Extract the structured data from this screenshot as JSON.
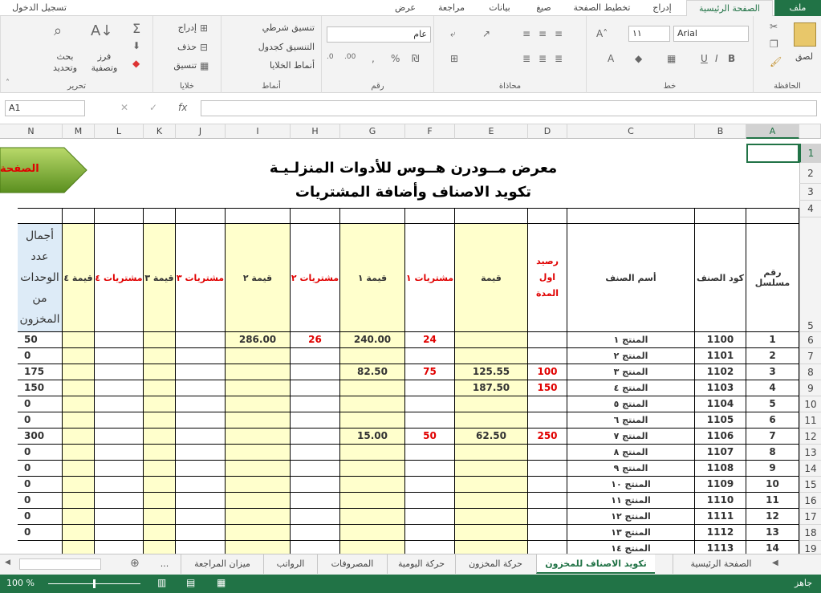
{
  "ribbon_tabs": [
    "ملف",
    "الصفحة الرئيسية",
    "إدراج",
    "تخطيط الصفحة",
    "صيغ",
    "بيانات",
    "مراجعة",
    "عرض"
  ],
  "signin": "تسجيل الدخول",
  "groups": {
    "clipboard": "الحافظة",
    "font": "خط",
    "alignment": "محاذاة",
    "number": "رقم",
    "styles": "أنماط",
    "cells": "خلايا",
    "editing": "تحرير"
  },
  "paste_label": "لصق",
  "font_name": "Arial",
  "font_size": "١١",
  "number_format": "عام",
  "styles_items": [
    "تنسيق شرطي",
    "التنسيق كجدول",
    "أنماط الخلايا"
  ],
  "cells_items": [
    "إدراج",
    "حذف",
    "تنسيق"
  ],
  "sort_label": "فرز وتصفية",
  "find_label": "بحث وتحديد",
  "name_box": "A1",
  "fx": "fx",
  "columns": [
    "A",
    "B",
    "C",
    "D",
    "E",
    "F",
    "G",
    "H",
    "I",
    "J",
    "K",
    "L",
    "M",
    "N"
  ],
  "rows": [
    "1",
    "2",
    "3",
    "4",
    "5",
    "6",
    "7",
    "8",
    "9",
    "10",
    "11",
    "12",
    "13",
    "14",
    "15",
    "16",
    "17",
    "18",
    "19"
  ],
  "title1": "معرض مــودرن هــوس للأدوات المنزلـيـة",
  "title2": "تكويد الاصناف وأضافة المشتريات",
  "nav_button": "الصفحة",
  "headers": {
    "serial": "رقم مسلسل",
    "code": "كود الصنف",
    "name": "أسم الصنف",
    "opening": "رصيد اول المدة",
    "value": "قيمة",
    "p1": "مشتريات ١",
    "v1": "قيمة ١",
    "p2": "مشتريات ٢",
    "v2": "قيمة ٢",
    "p3": "مشتريات ٣",
    "v3": "قيمة ٣",
    "p4": "مشتريات ٤",
    "v4": "قيمة ٤",
    "total": "أجمال عدد الوحدات من المخزون"
  },
  "table": [
    {
      "a": "1",
      "b": "1100",
      "c": "المنتج ١",
      "d": "",
      "e": "",
      "f": "24",
      "g": "240.00",
      "h": "26",
      "i": "286.00",
      "n": "50"
    },
    {
      "a": "2",
      "b": "1101",
      "c": "المنتج ٢",
      "d": "",
      "e": "",
      "f": "",
      "g": "",
      "h": "",
      "i": "",
      "n": "0"
    },
    {
      "a": "3",
      "b": "1102",
      "c": "المنتج ٣",
      "d": "100",
      "e": "125.55",
      "f": "75",
      "g": "82.50",
      "h": "",
      "i": "",
      "n": "175"
    },
    {
      "a": "4",
      "b": "1103",
      "c": "المنتج ٤",
      "d": "150",
      "e": "187.50",
      "f": "",
      "g": "",
      "h": "",
      "i": "",
      "n": "150"
    },
    {
      "a": "5",
      "b": "1104",
      "c": "المنتج ٥",
      "d": "",
      "e": "",
      "f": "",
      "g": "",
      "h": "",
      "i": "",
      "n": "0"
    },
    {
      "a": "6",
      "b": "1105",
      "c": "المنتج ٦",
      "d": "",
      "e": "",
      "f": "",
      "g": "",
      "h": "",
      "i": "",
      "n": "0"
    },
    {
      "a": "7",
      "b": "1106",
      "c": "المنتج ٧",
      "d": "250",
      "e": "62.50",
      "f": "50",
      "g": "15.00",
      "h": "",
      "i": "",
      "n": "300"
    },
    {
      "a": "8",
      "b": "1107",
      "c": "المنتج ٨",
      "d": "",
      "e": "",
      "f": "",
      "g": "",
      "h": "",
      "i": "",
      "n": "0"
    },
    {
      "a": "9",
      "b": "1108",
      "c": "المنتج ٩",
      "d": "",
      "e": "",
      "f": "",
      "g": "",
      "h": "",
      "i": "",
      "n": "0"
    },
    {
      "a": "10",
      "b": "1109",
      "c": "المنتج ١٠",
      "d": "",
      "e": "",
      "f": "",
      "g": "",
      "h": "",
      "i": "",
      "n": "0"
    },
    {
      "a": "11",
      "b": "1110",
      "c": "المنتج ١١",
      "d": "",
      "e": "",
      "f": "",
      "g": "",
      "h": "",
      "i": "",
      "n": "0"
    },
    {
      "a": "12",
      "b": "1111",
      "c": "المنتج ١٢",
      "d": "",
      "e": "",
      "f": "",
      "g": "",
      "h": "",
      "i": "",
      "n": "0"
    },
    {
      "a": "13",
      "b": "1112",
      "c": "المنتج ١٣",
      "d": "",
      "e": "",
      "f": "",
      "g": "",
      "h": "",
      "i": "",
      "n": "0"
    },
    {
      "a": "14",
      "b": "1113",
      "c": "المنتج ١٤",
      "d": "",
      "e": "",
      "f": "",
      "g": "",
      "h": "",
      "i": "",
      "n": ""
    }
  ],
  "sheet_tabs": [
    "الصفحة الرئيسية",
    "تكويد الاصناف للمخزون",
    "حركة المخزون",
    "حركة اليومية",
    "المصروفات",
    "الرواتب",
    "ميزان المراجعة",
    "..."
  ],
  "status_ready": "جاهز",
  "zoom": "100 %"
}
